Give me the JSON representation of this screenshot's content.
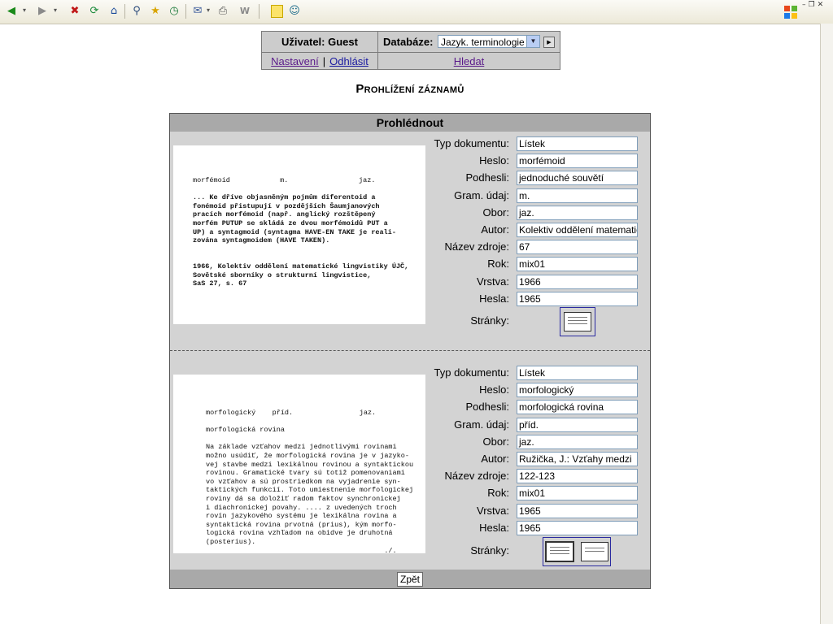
{
  "toolbar": {
    "icons": [
      "back-icon",
      "forward-icon",
      "stop-icon",
      "refresh-icon",
      "home-icon",
      "search-icon",
      "favorites-icon",
      "history-icon",
      "mail-icon",
      "print-icon",
      "edit-icon",
      "notes-icon",
      "messenger-icon"
    ]
  },
  "header": {
    "user_label": "Uživatel: Guest",
    "db_label": "Databáze:",
    "db_selected": "Jazyk. terminologie",
    "settings_link": "Nastavení",
    "separator": "|",
    "logout_link": "Odhlásit",
    "search_link": "Hledat"
  },
  "page": {
    "title": "Prohlížení záznamů"
  },
  "panel": {
    "heading": "Prohlédnout",
    "back_button": "Zpět"
  },
  "records": [
    {
      "fields": [
        {
          "label": "Typ dokumentu:",
          "value": "Lístek"
        },
        {
          "label": "Heslo:",
          "value": "morfémoid"
        },
        {
          "label": "Podhesli:",
          "value": "jednoduché souvětí"
        },
        {
          "label": "Gram. údaj:",
          "value": "m."
        },
        {
          "label": "Obor:",
          "value": "jaz."
        },
        {
          "label": "Autor:",
          "value": "Kolektiv oddělení matematic"
        },
        {
          "label": "Název zdroje:",
          "value": "67"
        },
        {
          "label": "Rok:",
          "value": "mix01"
        },
        {
          "label": "Vrstva:",
          "value": "1966"
        },
        {
          "label": "Hesla:",
          "value": "1965"
        }
      ],
      "pages_label": "Stránky:",
      "page_count": 1,
      "scan_text": [
        "morfémoid            m.                 jaz.",
        "",
        "... Ke dříve objasněným pojmům diferentoid a",
        "fonémoid přistupují v pozdějších Šaumjanových",
        "pracích morfémoid (např. anglický rozštěpený",
        "morfém PUTUP se skládá ze dvou morfémoidů PUT a",
        "UP) a syntagmoid (syntagma HAVE-EN TAKE je reali-",
        "zována syntagmoidem (HAVE TAKEN).",
        "",
        "",
        "1966, Kolektiv oddělení matematické lingvistiky ÚJČ,",
        "Sovětské sborníky o strukturní lingvistice,",
        "SaS 27, s. 67"
      ]
    },
    {
      "fields": [
        {
          "label": "Typ dokumentu:",
          "value": "Lístek"
        },
        {
          "label": "Heslo:",
          "value": "morfologický"
        },
        {
          "label": "Podhesli:",
          "value": "morfologická rovina"
        },
        {
          "label": "Gram. údaj:",
          "value": "příd."
        },
        {
          "label": "Obor:",
          "value": "jaz."
        },
        {
          "label": "Autor:",
          "value": "Ružička, J.: Vzťahy medzi"
        },
        {
          "label": "Název zdroje:",
          "value": "122-123"
        },
        {
          "label": "Rok:",
          "value": "mix01"
        },
        {
          "label": "Vrstva:",
          "value": "1965"
        },
        {
          "label": "Hesla:",
          "value": "1965"
        }
      ],
      "pages_label": "Stránky:",
      "page_count": 2,
      "scan_text": [
        "morfologický    příd.                jaz.",
        "",
        "morfologická rovina",
        "",
        "Na základe vzťahov medzi jednotlivými rovinami",
        "možno usúdiť, že morfologická rovina je v jazyko-",
        "vej stavbe medzi lexikálnou rovinou a syntaktickou",
        "rovinou. Gramatické tvary sú totiž pomenovaniami",
        "vo vzťahov a sú prostriedkom na vyjadrenie syn-",
        "taktických funkcií. Toto umiestnenie morfologickej",
        "roviny dá sa doložiť radom faktov synchronickej",
        "i diachronickej povahy. .... z uvedených troch",
        "rovín jazykového systému je lexikálna rovina a",
        "syntaktická rovina prvotná (prius), kým morfo-",
        "logická rovina vzhľadom na obidve je druhotná",
        "(posterius).",
        "                                           ./."
      ]
    }
  ],
  "colors": {
    "panel_bg": "#d3d3d3",
    "panel_header": "#a9a9a9",
    "link": "#5a1a8a",
    "thumb_border": "#2a2aa0"
  }
}
